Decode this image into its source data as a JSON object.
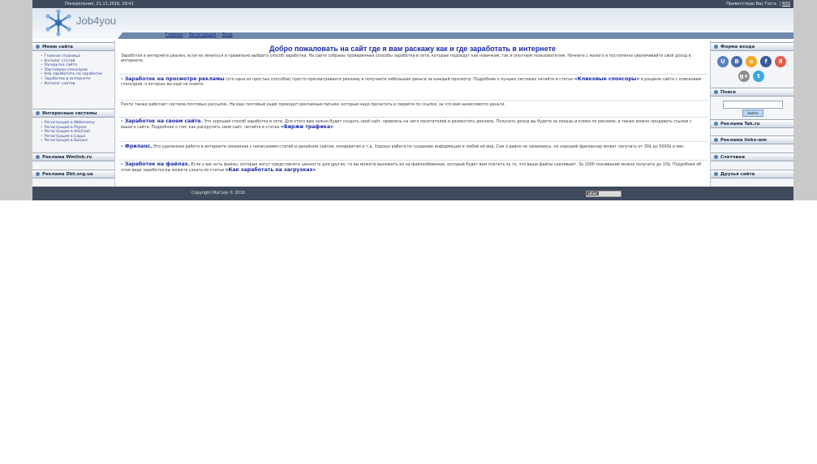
{
  "topbar": {
    "greeting": "Понедельник, 21.11.2016, 19:41",
    "welcome": "Приветствую Вас Гость",
    "sep": "|",
    "rss": "RSS"
  },
  "logo": {
    "text": "Job4you"
  },
  "nav": {
    "items": [
      "Главная",
      "Регистрация",
      "Вход"
    ],
    "sep": "|"
  },
  "left": {
    "menu_title": "Меню сайта",
    "menu_items": [
      "Главная страница",
      "Каталог статей",
      "Раскрутка сайта",
      "Партнерки спонсоров",
      "Как заработать на заработке",
      "Заработок в интернете",
      "Каталог сайтов"
    ],
    "partners_title": "Интересные системы",
    "partner_items": [
      "Регистрация в Webmoney",
      "Регистрация в Payeer",
      "Регистрация в AdvCash",
      "Регистрация в Capps",
      "Регистрация в Бинанс"
    ],
    "ad1_title": "Реклама Wmlink.ru",
    "ad2_title": "Реклама Dbt.org.ua"
  },
  "main": {
    "title": "Добро пожаловать на сайт где я вам раскажу как и где заработать в интернете",
    "intro": "Заработок в интернете реален, если не лениться и правильно выбрать способ заработка. На сайте собраны проверенные способы заработка в сети, которые подойдут как новичкам, так и опытным пользователям. Начните с малого и постепенно увеличивайте свой доход в интернете.",
    "s1_lead": "- Заработок на просмотре рекламы",
    "s1_text": "(это одна из простых способов) просто просматриваете рекламу и получаете небольшие деньги за каждый просмотр. Подробнее о лучших системах читайте в статье",
    "s1_link": "«Кликовые спонсоры»",
    "s1_tail": "в разделе сайта с описанием спонсоров, о которых вы ещё не знаете.",
    "s2_text": "Почти также работает система почтовых рассылок. На ваш почтовый ящик приходят рекламные письма, которые надо прочитать и перейти по ссылке, за что вам начисляются деньги.",
    "s3_lead": "- Заработок на своем сайте.",
    "s3_text": "Это хороший способ заработка в сети. Для этого вам нужно будет создать свой сайт, привлечь на него посетителей и разместить рекламу. Получать доход вы будете за показы и клики по рекламе, а также можно продавать ссылки с вашего сайта. Подробнее о том, как раскрутить свой сайт, читайте в статье",
    "s3_link": "«Биржи трафика»",
    "s4_lead": "- Фриланс.",
    "s4_text": "Это удаленная работа в интернете связанная с написанием статей и дизайном сайтов, копирайтом и т.д. Хорошо работа по созданию информации и любой её вид. Сам я давно не занимаюсь, но хороший фрилансер может получать от 30$ до 5000$ в мес.",
    "s5_lead": "- Заработок на файлах.",
    "s5_text": "Если у вас есть файлы, которые могут представлять ценность для других, то вы можете выложить их на файлообменник, который будет вам платить за то, что ваши файлы скачивают. За 1000 скачиваний можно получить до 10$. Подробнее об этом виде заработка вы можете узнать из статьи",
    "s5_link": "«Как заработать на загрузках»"
  },
  "right": {
    "login_title": "Форма входа",
    "social": [
      {
        "label": "U",
        "color": "#5a7fc2"
      },
      {
        "label": "B",
        "color": "#4b6fa8"
      },
      {
        "label": "o",
        "color": "#f5a623"
      },
      {
        "label": "f",
        "color": "#3b5998"
      },
      {
        "label": "Я",
        "color": "#e65c4c"
      },
      {
        "label": "g+",
        "color": "#8c8c8c"
      },
      {
        "label": "t",
        "color": "#3ca8e0"
      }
    ],
    "search_title": "Поиск",
    "search_button": "Найти",
    "ad1_title": "Реклама Tak.ru",
    "ad2_title": "Реклама links-wm",
    "counter_title": "Счетчики",
    "friends_title": "Друзья сайта"
  },
  "footer": {
    "copyright": "Copyright MyCorp © 2016",
    "badge_left": "uCoz",
    "badge_right": ""
  }
}
